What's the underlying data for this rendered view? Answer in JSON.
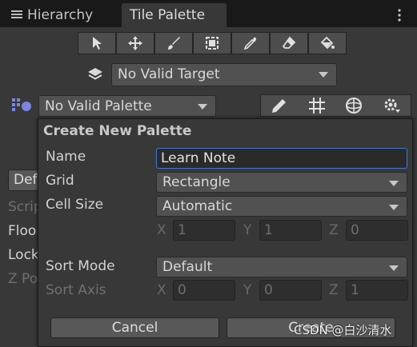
{
  "tabs": {
    "hierarchy": "Hierarchy",
    "tile_palette": "Tile Palette"
  },
  "target": {
    "selected": "No Valid Target"
  },
  "palette": {
    "selected": "No Valid Palette"
  },
  "background_panel": {
    "default_button": "Def",
    "rows": [
      "Scrip",
      "Floo",
      "Lock",
      "Z Po"
    ]
  },
  "popup": {
    "title": "Create New Palette",
    "name_label": "Name",
    "name_value": "Learn Note",
    "grid_label": "Grid",
    "grid_value": "Rectangle",
    "cell_size_label": "Cell Size",
    "cell_size_value": "Automatic",
    "cell_size_axes": {
      "x_label": "X",
      "x_value": "1",
      "y_label": "Y",
      "y_value": "1",
      "z_label": "Z",
      "z_value": "0"
    },
    "sort_mode_label": "Sort Mode",
    "sort_mode_value": "Default",
    "sort_axis_label": "Sort Axis",
    "sort_axis": {
      "x_label": "X",
      "x_value": "0",
      "y_label": "Y",
      "y_value": "0",
      "z_label": "Z",
      "z_value": "1"
    },
    "cancel": "Cancel",
    "create": "Create"
  },
  "watermark": "CSDN @白沙清水",
  "colors": {
    "focus": "#3d7ad6",
    "panel": "#383838",
    "tabbar": "#191919"
  }
}
